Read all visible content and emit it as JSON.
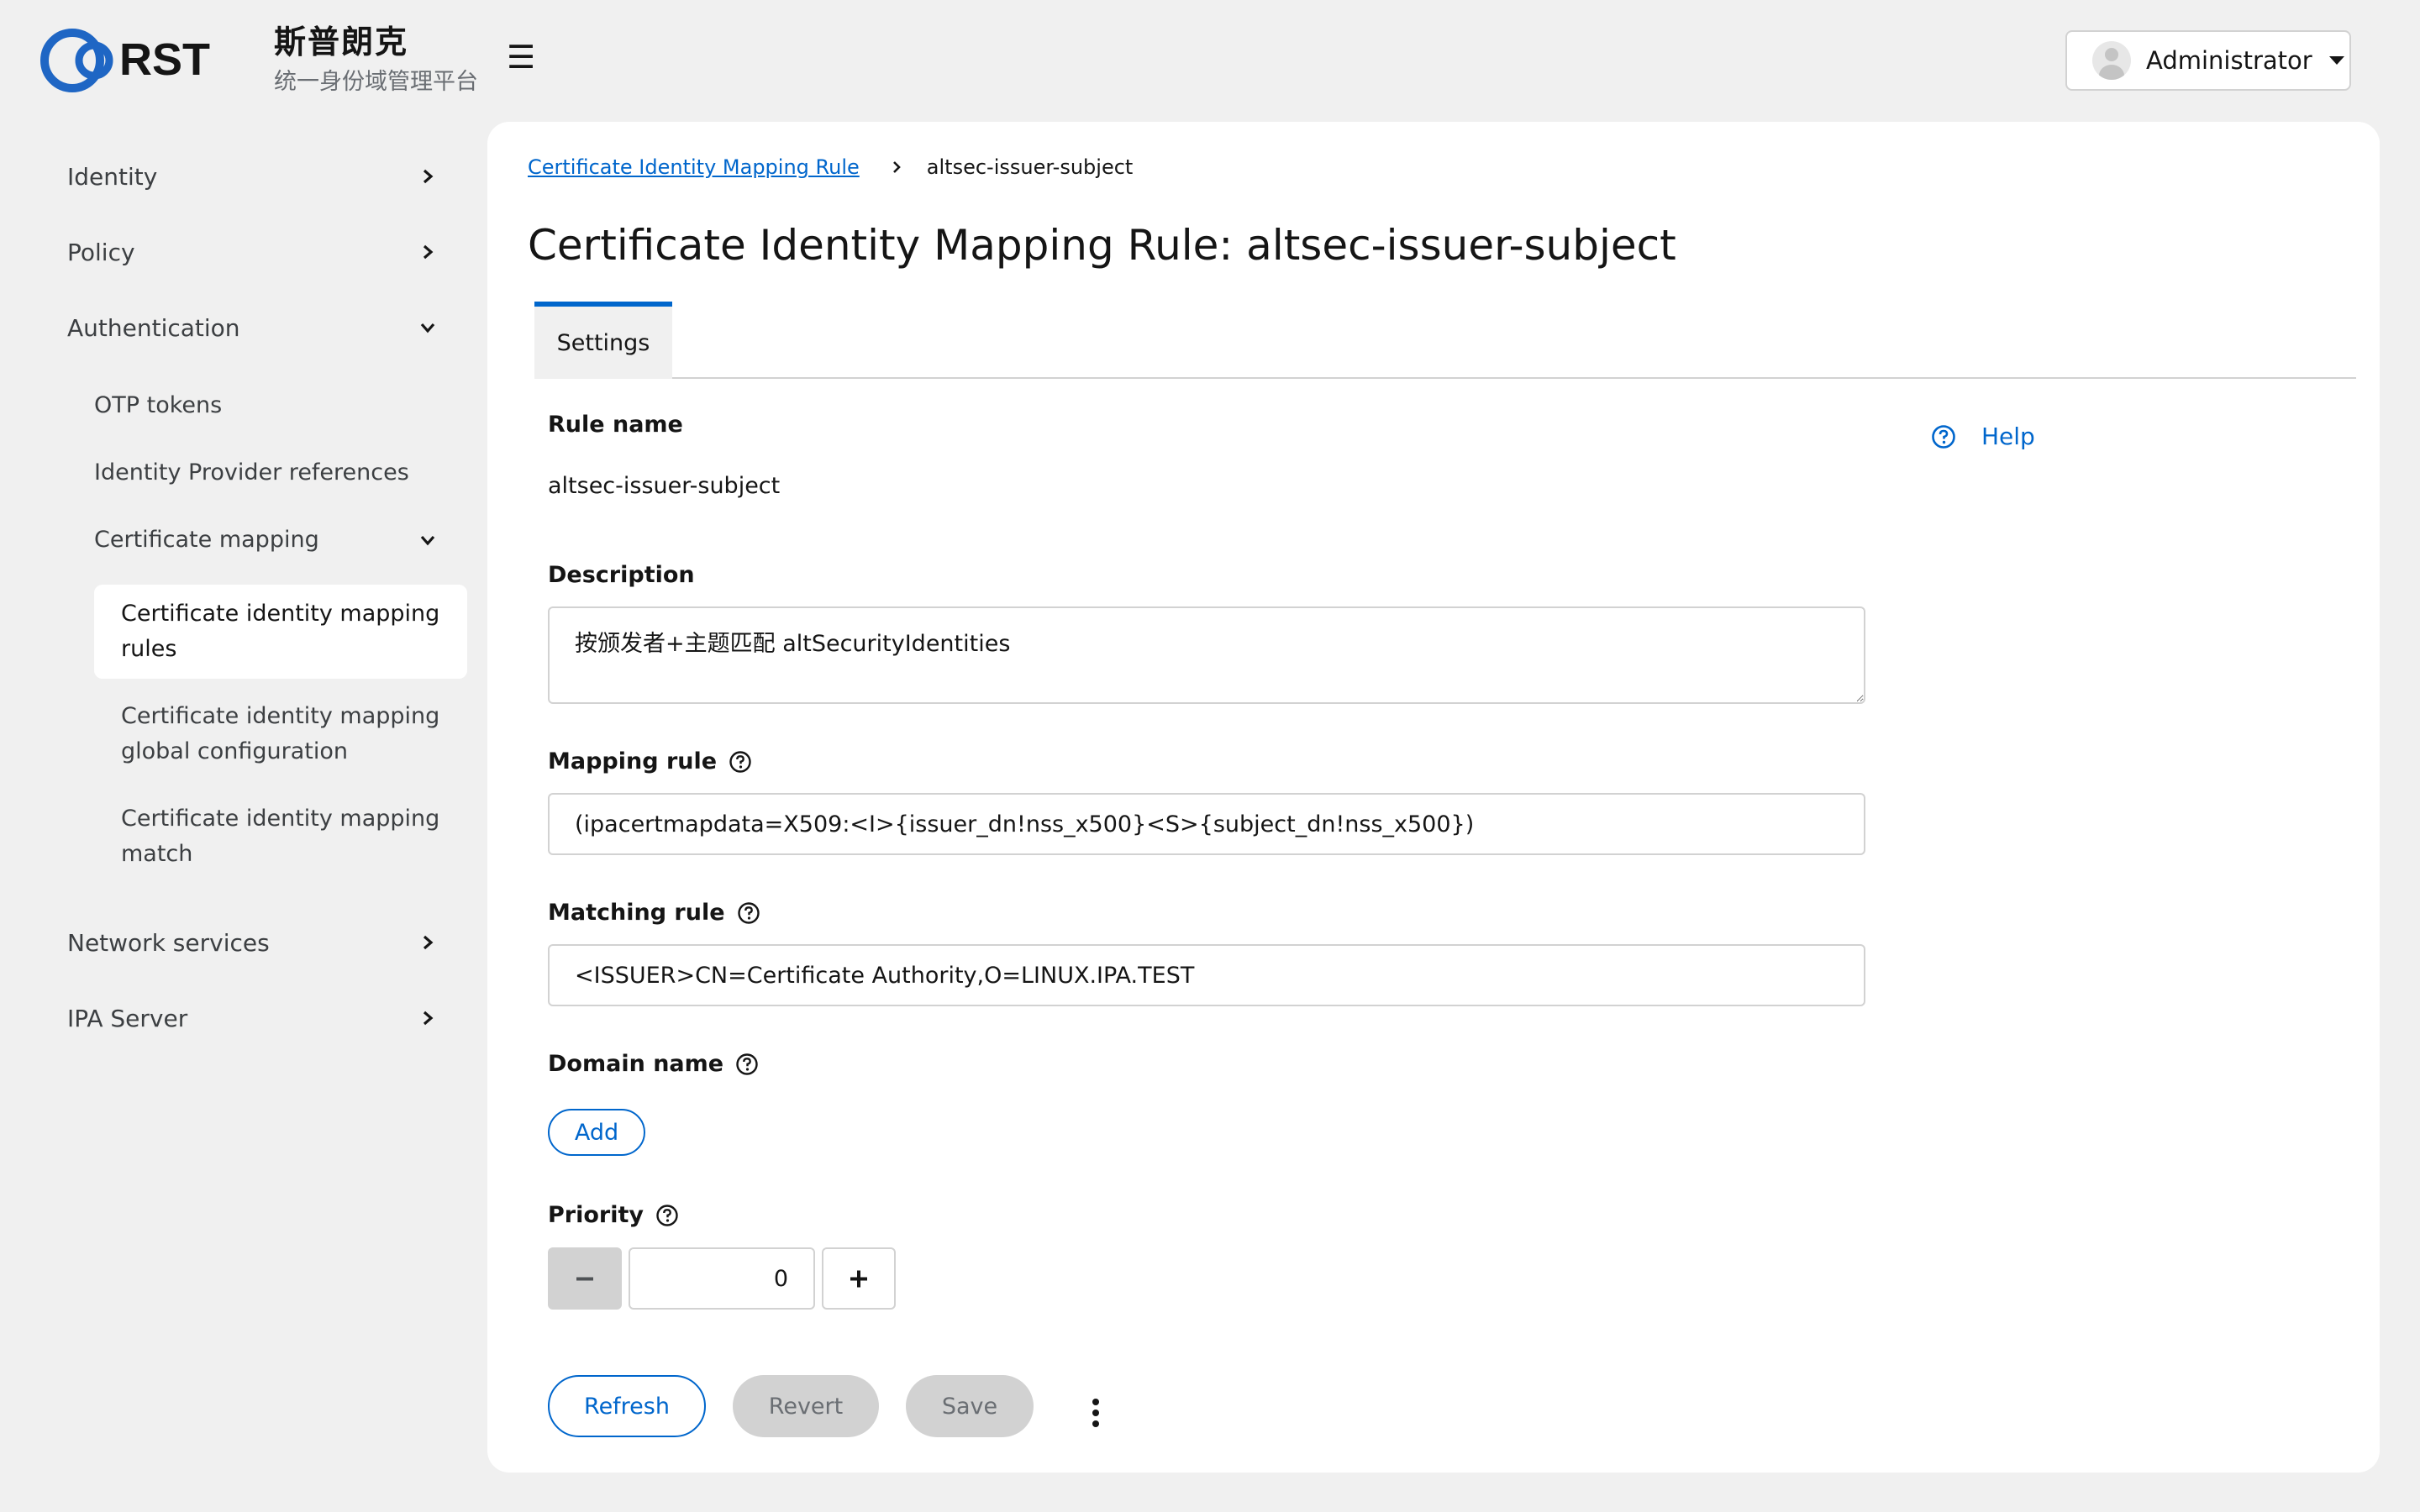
{
  "brand": {
    "logo_text": "RST",
    "name": "斯普朗克",
    "subtitle": "统一身份域管理平台"
  },
  "user_menu": {
    "label": "Administrator"
  },
  "sidebar": {
    "items": [
      {
        "label": "Identity"
      },
      {
        "label": "Policy"
      },
      {
        "label": "Authentication"
      },
      {
        "label": "Network services"
      },
      {
        "label": "IPA Server"
      }
    ],
    "authentication_children": [
      {
        "label": "OTP tokens"
      },
      {
        "label": "Identity Provider references"
      },
      {
        "label": "Certificate mapping"
      }
    ],
    "certificate_mapping_children": [
      {
        "label": "Certificate identity mapping rules"
      },
      {
        "label": "Certificate identity mapping global configuration"
      },
      {
        "label": "Certificate identity mapping match"
      }
    ]
  },
  "breadcrumb": {
    "parent": "Certificate Identity Mapping Rule",
    "current": "altsec-issuer-subject"
  },
  "page": {
    "title": "Certificate Identity Mapping Rule: altsec-issuer-subject"
  },
  "tabs": [
    {
      "label": "Settings"
    }
  ],
  "help": {
    "label": "Help"
  },
  "form": {
    "rule_name": {
      "label": "Rule name",
      "value": "altsec-issuer-subject"
    },
    "description": {
      "label": "Description",
      "value": "按颁发者+主题匹配 altSecurityIdentities"
    },
    "mapping_rule": {
      "label": "Mapping rule",
      "value": "(ipacertmapdata=X509:<I>{issuer_dn!nss_x500}<S>{subject_dn!nss_x500})"
    },
    "matching_rule": {
      "label": "Matching rule",
      "value": "<ISSUER>CN=Certificate Authority,O=LINUX.IPA.TEST"
    },
    "domain_name": {
      "label": "Domain name",
      "add_label": "Add"
    },
    "priority": {
      "label": "Priority",
      "value": "0"
    }
  },
  "actions": {
    "refresh": "Refresh",
    "revert": "Revert",
    "save": "Save"
  },
  "colors": {
    "accent": "#0066cc",
    "page_bg": "#f0f0f0",
    "card_bg": "#ffffff",
    "disabled_bg": "#d2d2d2",
    "border": "#d2d2d2"
  }
}
